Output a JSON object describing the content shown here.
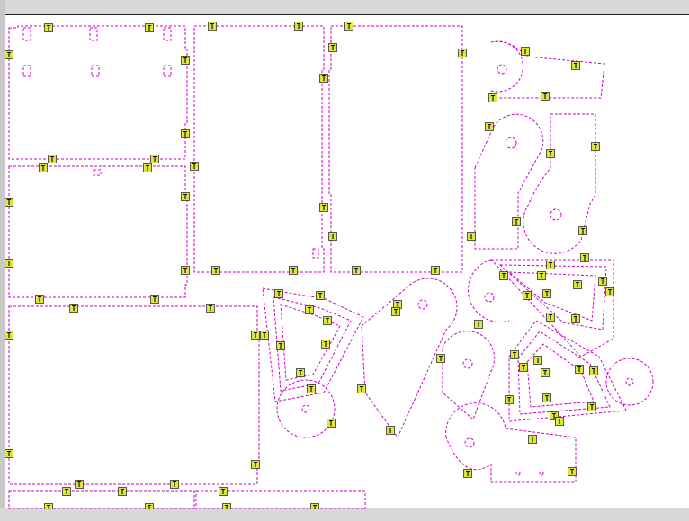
{
  "app": {
    "view": "nesting-layout-canvas",
    "colors": {
      "background": "#ffffff",
      "frame": "#d4d4d4",
      "outline": "#cc00cc",
      "tag_fill": "#dde63a",
      "tag_border": "#333333"
    }
  },
  "tabs": {
    "label": "T"
  }
}
